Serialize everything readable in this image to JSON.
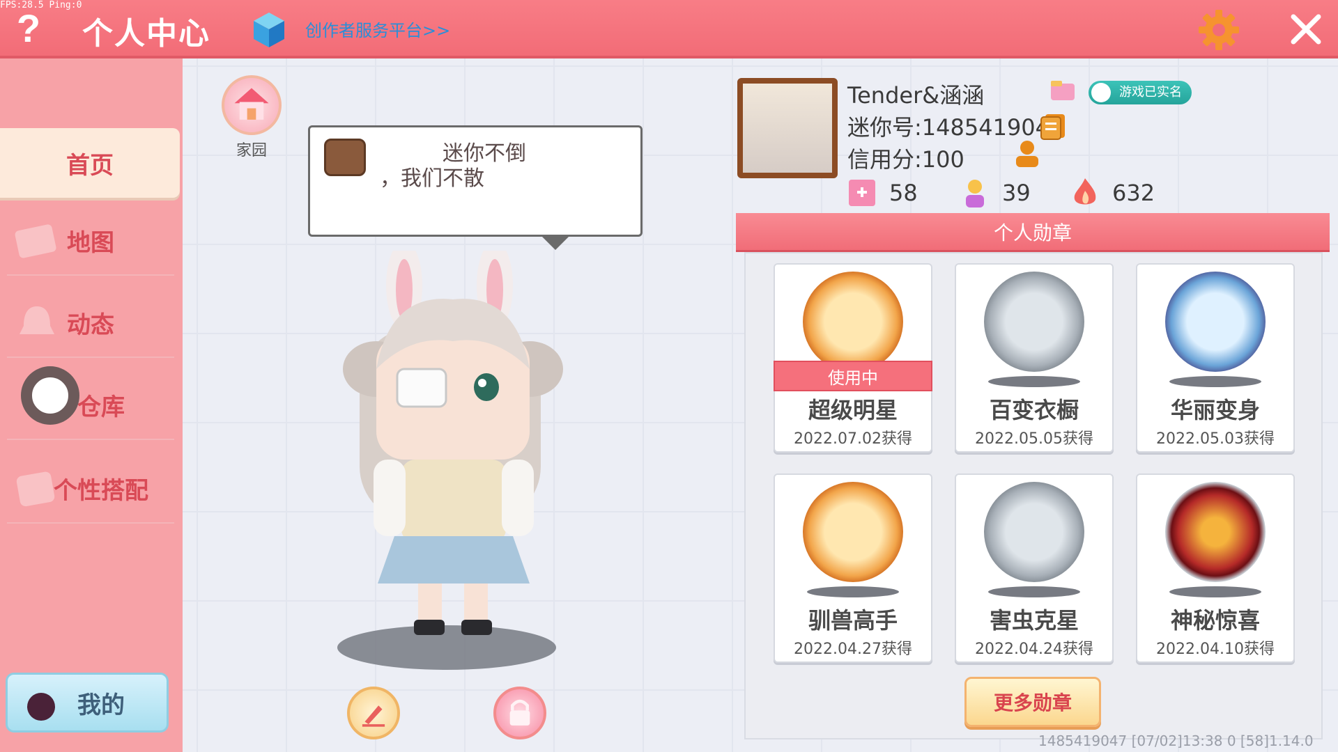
{
  "debug": {
    "fps_text": "FPS:28.5  Ping:0"
  },
  "header": {
    "help_label": "?",
    "title": "个人中心",
    "creator_link": "创作者服务平台>>"
  },
  "sidebar": {
    "items": [
      {
        "label": "首页",
        "active": true
      },
      {
        "label": "地图",
        "active": false
      },
      {
        "label": "动态",
        "active": false
      },
      {
        "label": "仓库",
        "active": false
      },
      {
        "label": "个性搭配",
        "active": false
      }
    ],
    "mine_label": "我的"
  },
  "avatar_area": {
    "home_label": "家园",
    "speech_line1": "迷你不倒",
    "speech_line2": "，我们不散"
  },
  "profile": {
    "username": "Tender&涵涵",
    "mini_id": "迷你号:1485419047",
    "credit": "信用分:100",
    "verified_label": "游戏已实名",
    "stats": {
      "likes": "58",
      "popularity": "39",
      "hot": "632"
    }
  },
  "medals": {
    "header": "个人勋章",
    "in_use_label": "使用中",
    "items": [
      {
        "name": "超级明星",
        "date": "2022.07.02获得",
        "style": "gold",
        "in_use": true
      },
      {
        "name": "百变衣橱",
        "date": "2022.05.05获得",
        "style": "silver",
        "in_use": false
      },
      {
        "name": "华丽变身",
        "date": "2022.05.03获得",
        "style": "blue",
        "in_use": false
      },
      {
        "name": "驯兽高手",
        "date": "2022.04.27获得",
        "style": "gold",
        "in_use": false
      },
      {
        "name": "害虫克星",
        "date": "2022.04.24获得",
        "style": "silver",
        "in_use": false
      },
      {
        "name": "神秘惊喜",
        "date": "2022.04.10获得",
        "style": "red",
        "in_use": false
      }
    ],
    "more_label": "更多勋章"
  },
  "footer": {
    "info": "1485419047   [07/02]13:38 0  [58]1.14.0"
  },
  "colors": {
    "accent": "#f26c77",
    "sidebar": "#f7a2a7",
    "verified": "#25a49b"
  }
}
